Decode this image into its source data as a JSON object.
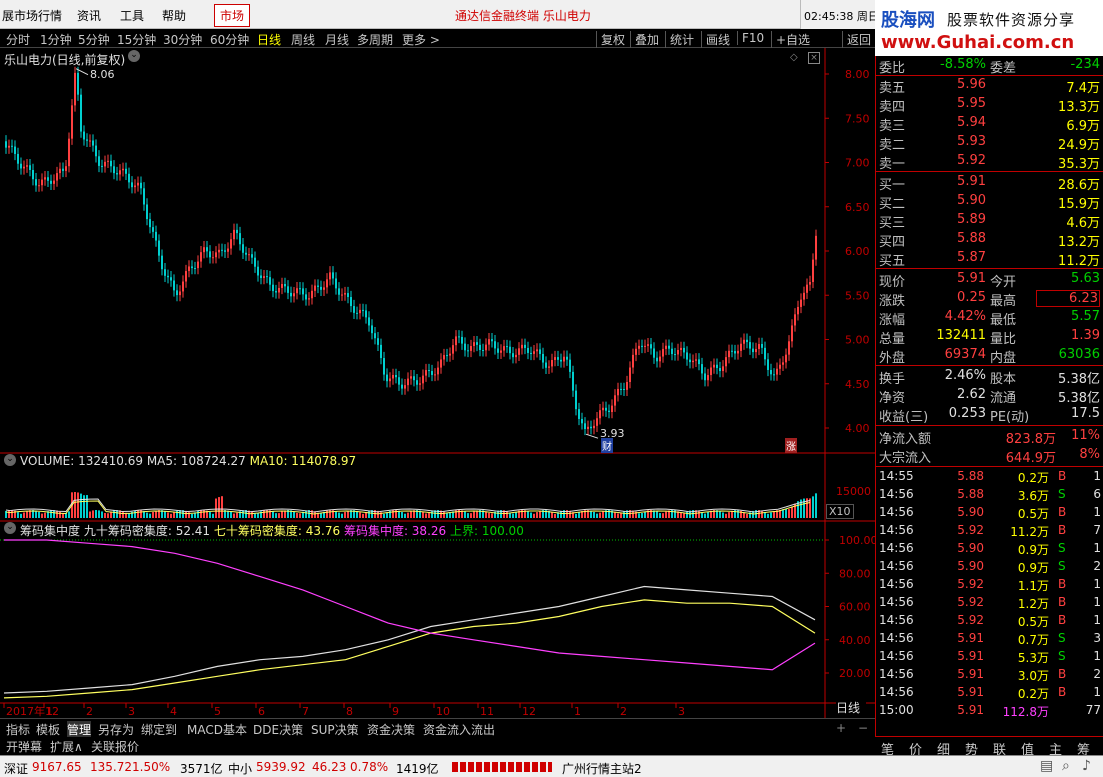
{
  "menu": {
    "items": [
      "展市场行情",
      "资讯",
      "工具",
      "帮助"
    ],
    "active": "市场",
    "marquee": "通达信金融终端  乐山电力",
    "clock": "02:45:38 周日"
  },
  "toolbar": {
    "periods": [
      "分时",
      "1分钟",
      "5分钟",
      "15分钟",
      "30分钟",
      "60分钟",
      "日线",
      "周线",
      "月线",
      "多周期",
      "更多 >"
    ],
    "selected": "日线",
    "actions": [
      "复权",
      "叠加",
      "统计",
      "画线",
      "F10",
      "+自选",
      "返回"
    ]
  },
  "logo": {
    "line1": "股海网",
    "line1b": "股票软件资源分享",
    "line2": "www.Guhai.com.cn"
  },
  "chart": {
    "title": "乐山电力(日线,前复权)",
    "price_axis": [
      "8.00",
      "7.50",
      "7.00",
      "6.50",
      "6.00",
      "5.50",
      "5.00",
      "4.50",
      "4.00"
    ],
    "high_label": "8.06",
    "low_label": "3.93",
    "marker_cai": "财",
    "marker_zhang": "涨",
    "volume_header": {
      "name": "VOLUME: 132410.69",
      "ma5": "MA5: 108724.27",
      "ma10": "MA10: 114078.97"
    },
    "volume_axis": "15000",
    "volume_unit": "X10",
    "chip_header": {
      "name": "筹码集中度",
      "c90": "九十筹码密集度: 52.41",
      "c70": "七十筹码密集度: 43.76",
      "conc": "筹码集中度: 38.26",
      "upper": "上界: 100.00"
    },
    "chip_axis": [
      "100.00",
      "80.00",
      "60.00",
      "40.00",
      "20.00"
    ],
    "date_axis": [
      "2017年12",
      "1",
      "2",
      "3",
      "4",
      "5",
      "6",
      "7",
      "8",
      "9",
      "10",
      "11",
      "12",
      "1",
      "2",
      "3"
    ],
    "date_tag": "日线"
  },
  "chart_data": {
    "type": "line",
    "title": "乐山电力(日线,前复权)",
    "series": [
      {
        "name": "九十筹码密集度",
        "values": [
          8,
          9,
          11,
          13,
          18,
          24,
          28,
          30,
          34,
          40,
          48,
          52,
          56,
          60,
          66,
          72,
          70,
          68,
          66,
          52
        ]
      },
      {
        "name": "七十筹码密集度",
        "values": [
          5,
          6,
          8,
          10,
          14,
          18,
          22,
          25,
          28,
          36,
          44,
          48,
          50,
          54,
          60,
          64,
          62,
          62,
          60,
          44
        ]
      },
      {
        "name": "筹码集中度",
        "values": [
          100,
          100,
          98,
          96,
          92,
          86,
          78,
          70,
          60,
          50,
          44,
          40,
          36,
          32,
          30,
          28,
          26,
          24,
          22,
          38
        ]
      }
    ],
    "ylim": [
      0,
      100
    ]
  },
  "bottom_tabs": {
    "row1": [
      "指标",
      "模板",
      "管理",
      "另存为",
      "绑定到",
      "MACD基本",
      "DDE决策",
      "SUP决策",
      "资金决策",
      "资金流入流出"
    ],
    "row2": [
      "开弹幕",
      "扩展∧",
      "关联报价"
    ]
  },
  "panel": {
    "weibi": {
      "label": "委比",
      "value": "-8.58%",
      "label2": "委差",
      "value2": "-234"
    },
    "asks": [
      {
        "label": "卖五",
        "price": "5.96",
        "vol": "7.4万"
      },
      {
        "label": "卖四",
        "price": "5.95",
        "vol": "13.3万"
      },
      {
        "label": "卖三",
        "price": "5.94",
        "vol": "6.9万"
      },
      {
        "label": "卖二",
        "price": "5.93",
        "vol": "24.9万"
      },
      {
        "label": "卖一",
        "price": "5.92",
        "vol": "35.3万"
      }
    ],
    "bids": [
      {
        "label": "买一",
        "price": "5.91",
        "vol": "28.6万"
      },
      {
        "label": "买二",
        "price": "5.90",
        "vol": "15.9万"
      },
      {
        "label": "买三",
        "price": "5.89",
        "vol": "4.6万"
      },
      {
        "label": "买四",
        "price": "5.88",
        "vol": "13.2万"
      },
      {
        "label": "买五",
        "price": "5.87",
        "vol": "11.2万"
      }
    ],
    "quote": [
      {
        "l1": "现价",
        "v1": "5.91",
        "l2": "今开",
        "v2": "5.63"
      },
      {
        "l1": "涨跌",
        "v1": "0.25",
        "l2": "最高",
        "v2": "6.23"
      },
      {
        "l1": "涨幅",
        "v1": "4.42%",
        "l2": "最低",
        "v2": "5.57"
      },
      {
        "l1": "总量",
        "v1": "132411",
        "l2": "量比",
        "v2": "1.39"
      },
      {
        "l1": "外盘",
        "v1": "69374",
        "l2": "内盘",
        "v2": "63036"
      }
    ],
    "fund": [
      {
        "l1": "换手",
        "v1": "2.46%",
        "l2": "股本",
        "v2": "5.38亿"
      },
      {
        "l1": "净资",
        "v1": "2.62",
        "l2": "流通",
        "v2": "5.38亿"
      },
      {
        "l1": "收益(三)",
        "v1": "0.253",
        "l2": "PE(动)",
        "v2": "17.5"
      }
    ],
    "flow": [
      {
        "label": "净流入额",
        "value": "823.8万",
        "pct": "11%"
      },
      {
        "label": "大宗流入",
        "value": "644.9万",
        "pct": "8%"
      }
    ],
    "trades": [
      {
        "t": "14:55",
        "p": "5.88",
        "v": "0.2万",
        "d": "B",
        "n": "1"
      },
      {
        "t": "14:56",
        "p": "5.88",
        "v": "3.6万",
        "d": "S",
        "n": "6"
      },
      {
        "t": "14:56",
        "p": "5.90",
        "v": "0.5万",
        "d": "B",
        "n": "1"
      },
      {
        "t": "14:56",
        "p": "5.92",
        "v": "11.2万",
        "d": "B",
        "n": "7"
      },
      {
        "t": "14:56",
        "p": "5.90",
        "v": "0.9万",
        "d": "S",
        "n": "1"
      },
      {
        "t": "14:56",
        "p": "5.90",
        "v": "0.9万",
        "d": "S",
        "n": "2"
      },
      {
        "t": "14:56",
        "p": "5.92",
        "v": "1.1万",
        "d": "B",
        "n": "1"
      },
      {
        "t": "14:56",
        "p": "5.92",
        "v": "1.2万",
        "d": "B",
        "n": "1"
      },
      {
        "t": "14:56",
        "p": "5.92",
        "v": "0.5万",
        "d": "B",
        "n": "1"
      },
      {
        "t": "14:56",
        "p": "5.91",
        "v": "0.7万",
        "d": "S",
        "n": "3"
      },
      {
        "t": "14:56",
        "p": "5.91",
        "v": "5.3万",
        "d": "S",
        "n": "1"
      },
      {
        "t": "14:56",
        "p": "5.91",
        "v": "3.0万",
        "d": "B",
        "n": "2"
      },
      {
        "t": "14:56",
        "p": "5.91",
        "v": "0.2万",
        "d": "B",
        "n": "1"
      },
      {
        "t": "15:00",
        "p": "5.91",
        "v": "112.8万",
        "d": "",
        "n": "77"
      }
    ],
    "tabs": [
      "笔",
      "价",
      "细",
      "势",
      "联",
      "值",
      "主",
      "筹"
    ]
  },
  "status": {
    "sz_label": "深证",
    "sz_value": "9167.65",
    "sz_chg": "135.72",
    "sz_pct": "1.50%",
    "sz_amt": "3571亿",
    "zx_label": "中小",
    "zx_value": "5939.92",
    "zx_chg": "46.23",
    "zx_pct": "0.78%",
    "zx_amt": "1419亿",
    "server": "广州行情主站2"
  },
  "colors": {
    "up": "#ff4040",
    "down": "#00d0d0",
    "ma_white": "#e0e0e0",
    "ma_yellow": "#ffff60",
    "magenta": "#ff40ff",
    "border": "#c00000"
  }
}
